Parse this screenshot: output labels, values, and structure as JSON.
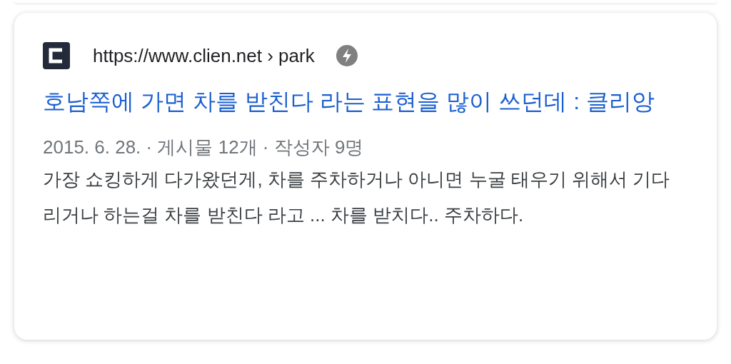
{
  "result": {
    "site_url": "https://www.clien.net › park",
    "title": "호남쪽에 가면 차를 받친다 라는 표현을 많이 쓰던데 : 클리앙",
    "meta": "2015. 6. 28. · 게시물 12개 · 작성자 9명",
    "snippet": "가장 쇼킹하게 다가왔던게, 차를 주차하거나 아니면 누굴 태우기 위해서 기다리거나 하는걸 차를 받친다 라고 ... 차를 받치다.. 주차하다."
  }
}
